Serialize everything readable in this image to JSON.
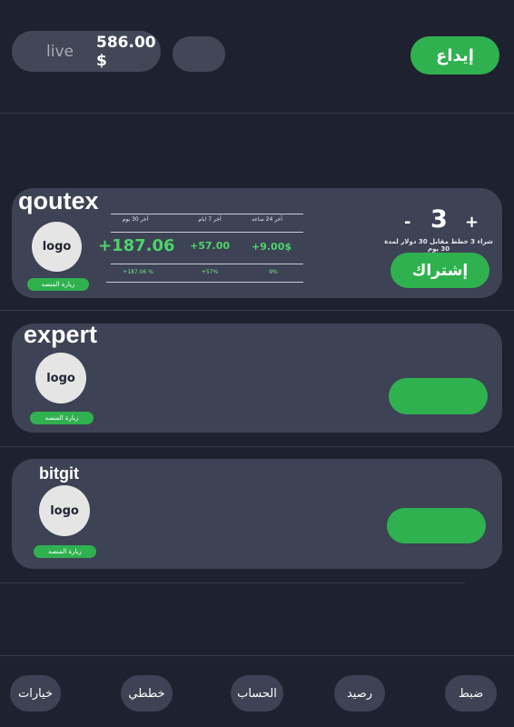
{
  "header": {
    "mode": "live",
    "balance": "586.00 $",
    "deposit_label": "إيداع"
  },
  "cards": [
    {
      "name": "qoutex",
      "logo": "logo",
      "visit_label": "زيارة المنصه",
      "stats": {
        "headers": [
          "آخر 30 يوم",
          "آخر 7 ايام",
          "آخر 24 ساعه"
        ],
        "values": [
          "+187.06",
          "+57.00",
          "+9.00$"
        ],
        "percents": [
          "+187.06 %",
          "+57%",
          "9%"
        ]
      },
      "counter": {
        "minus": "-",
        "value": "3",
        "plus": "+"
      },
      "plan_text": "شراء 3 خطط مقابل 30 دولار لمدة 30 يوم",
      "subscribe_label": "إشتراك"
    },
    {
      "name": "expert",
      "logo": "logo",
      "visit_label": "زيارة المنصه"
    },
    {
      "name": "bitgit",
      "logo": "logo",
      "visit_label": "زيارة المنصه"
    }
  ],
  "nav": {
    "items": [
      "خيارات",
      "خططي",
      "الحساب",
      "رصيد",
      "ضبط"
    ]
  },
  "colors": {
    "background": "#1e2230",
    "card": "#3d4254",
    "accent_green": "#2fb14f",
    "value_green": "#4ed36a"
  }
}
